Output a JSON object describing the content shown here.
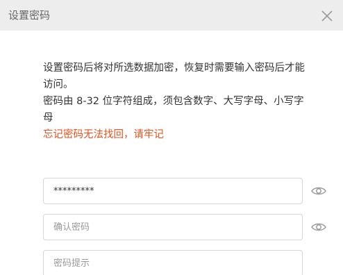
{
  "dialog": {
    "title": "设置密码",
    "description": {
      "line1": "设置密码后将对所选数据加密，恢复时需要输入密码后才能访问。",
      "line2": "密码由 8-32 位字符组成，须包含数字、大写字母、小写字母",
      "warning": "忘记密码无法找回，请牢记"
    },
    "fields": {
      "password": {
        "value": "*********",
        "placeholder": ""
      },
      "confirm": {
        "value": "",
        "placeholder": "确认密码"
      },
      "hint": {
        "value": "",
        "placeholder": "密码提示"
      }
    },
    "icons": {
      "close": "close-icon",
      "show_password": "eye-icon"
    },
    "colors": {
      "warning": "#e8501c",
      "titlebar": "#ededed"
    }
  }
}
